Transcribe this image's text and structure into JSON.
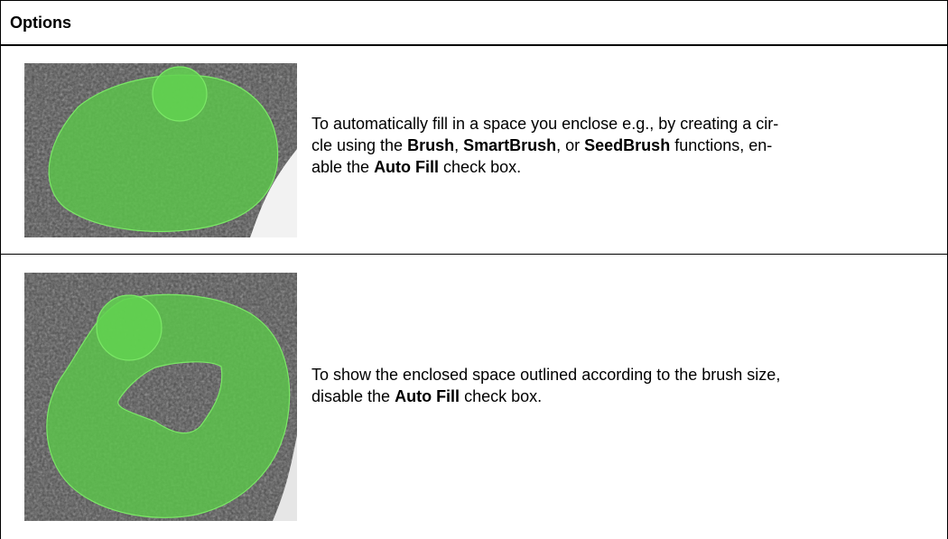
{
  "header": {
    "title": "Options"
  },
  "rows": [
    {
      "image_icon": "auto-fill-enabled-brush-image",
      "text": {
        "l1": "To automatically fill in a space you enclose e.g., by creating a cir-",
        "l2_a": "cle using the ",
        "l2_b": "Brush",
        "l2_c": ", ",
        "l2_d": "SmartBrush",
        "l2_e": ", or ",
        "l2_f": "SeedBrush",
        "l2_g": " functions, en-",
        "l3_a": "able the ",
        "l3_b": "Auto Fill",
        "l3_c": " check box."
      }
    },
    {
      "image_icon": "auto-fill-disabled-brush-image",
      "text": {
        "l1": "To show the enclosed space outlined according to the brush size,",
        "l2_a": "disable the ",
        "l2_b": "Auto Fill",
        "l2_c": " check box."
      }
    }
  ],
  "colors": {
    "fill": "#5cc64a",
    "outline": "#6fe05c",
    "background": "#4a4a4a"
  }
}
